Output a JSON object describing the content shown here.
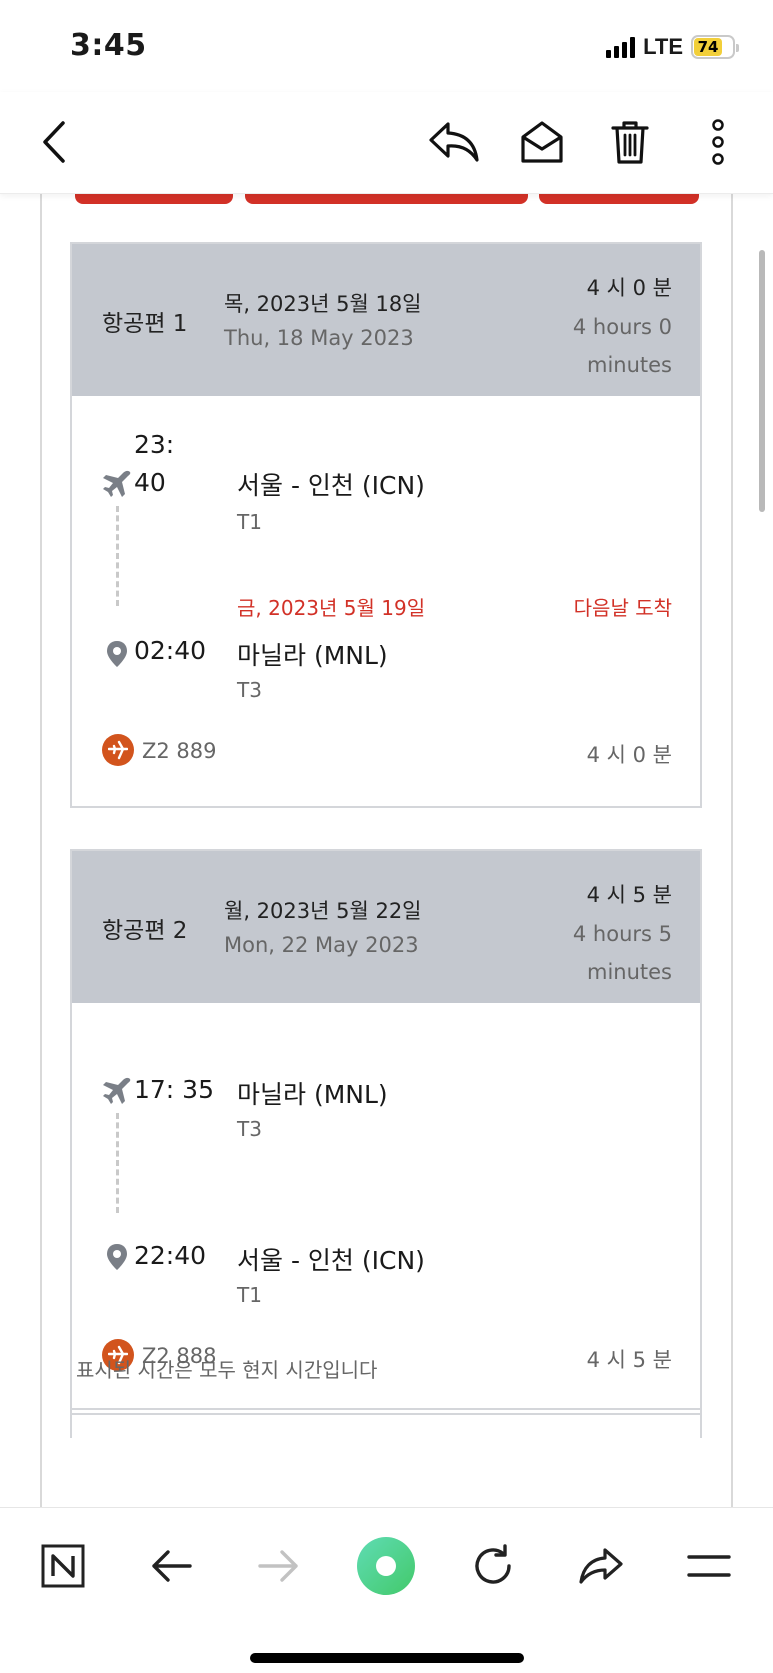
{
  "status_bar": {
    "time": "3:45",
    "network": "LTE",
    "battery": "74"
  },
  "toolbar": {
    "back_icon": "chevron-left-icon",
    "reply_icon": "reply-icon",
    "mark_unread_icon": "open-envelope-icon",
    "delete_icon": "trash-icon",
    "more_icon": "more-vertical-icon"
  },
  "colors": {
    "accent_red": "#d23127",
    "header_gray": "#c4c8cf",
    "airline_orange": "#d2541d"
  },
  "segments": [
    {
      "label": "항공편 1",
      "date_ko": "목, 2023년 5월 18일",
      "date_en": "Thu, 18 May 2023",
      "duration_ko": "4 시 0 분",
      "duration_en": "4 hours 0 minutes",
      "departure": {
        "time_line1": "23:",
        "time_line2": "40",
        "airport": "서울 - 인천 (ICN)",
        "terminal": "T1"
      },
      "arrival": {
        "date_note": "금, 2023년 5월 19일",
        "next_day": "다음날 도착",
        "time": "02:40",
        "airport": "마닐라 (MNL)",
        "terminal": "T3"
      },
      "flight_number": "Z2 889",
      "flight_duration": "4 시 0 분"
    },
    {
      "label": "항공편 2",
      "date_ko": "월, 2023년 5월 22일",
      "date_en": "Mon, 22 May 2023",
      "duration_ko": "4 시 5 분",
      "duration_en": "4 hours 5 minutes",
      "departure": {
        "time": "17: 35",
        "airport": "마닐라 (MNL)",
        "terminal": "T3"
      },
      "arrival": {
        "time": "22:40",
        "airport": "서울 - 인천 (ICN)",
        "terminal": "T1"
      },
      "flight_number": "Z2 888",
      "flight_duration": "4 시 5 분"
    }
  ],
  "footnote": "표시된 시간은 모두 현지 시간입니다",
  "browser_bar": {
    "n_icon": "naver-n-icon",
    "back_icon": "arrow-left-icon",
    "forward_icon": "arrow-right-icon",
    "green_dot_icon": "green-dot-icon",
    "reload_icon": "reload-icon",
    "share_icon": "share-icon",
    "menu_icon": "menu-icon"
  }
}
